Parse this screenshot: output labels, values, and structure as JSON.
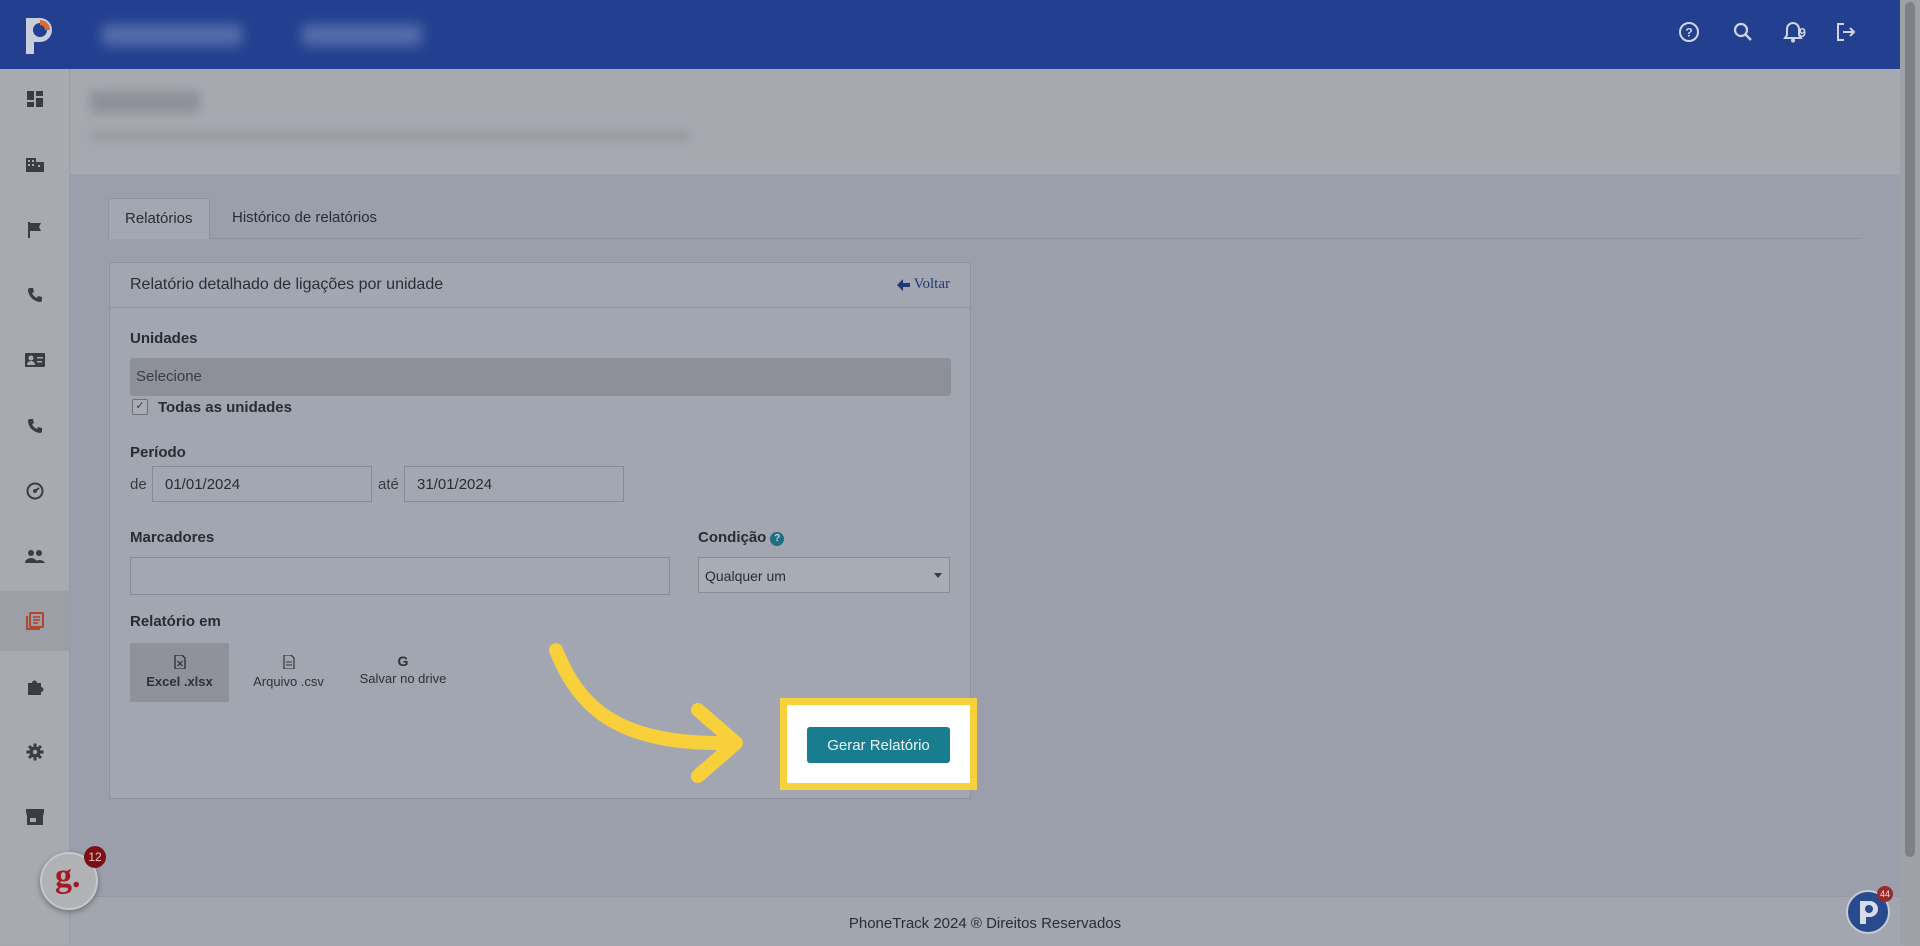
{
  "topbar": {
    "notification_count": "9",
    "icons": [
      "help-icon",
      "search-icon",
      "bell-icon",
      "logout-icon"
    ]
  },
  "sidebar": {
    "items": [
      {
        "icon": "dashboard-icon"
      },
      {
        "icon": "building-icon"
      },
      {
        "icon": "flag-icon"
      },
      {
        "icon": "phone-icon"
      },
      {
        "icon": "contact-card-icon"
      },
      {
        "icon": "phone-call-icon"
      },
      {
        "icon": "speed-icon"
      },
      {
        "icon": "users-icon"
      },
      {
        "icon": "reports-icon",
        "active": true
      },
      {
        "icon": "puzzle-icon"
      },
      {
        "icon": "gear-icon"
      },
      {
        "icon": "store-icon"
      }
    ]
  },
  "tabs": [
    {
      "label": "Relatórios",
      "active": true
    },
    {
      "label": "Histórico de relatórios",
      "active": false
    }
  ],
  "card": {
    "title": "Relatório detalhado de ligações por unidade",
    "back_label": "Voltar",
    "unidades_label": "Unidades",
    "unidades_placeholder": "Selecione",
    "todas_label": "Todas as unidades",
    "todas_checked": true,
    "periodo_label": "Período",
    "de_label": "de",
    "date_start": "01/01/2024",
    "ate_label": "até",
    "date_end": "31/01/2024",
    "marcadores_label": "Marcadores",
    "marcadores_value": "",
    "condicao_label": "Condição",
    "condicao_value": "Qualquer um",
    "relatorio_em_label": "Relatório em",
    "formats": [
      {
        "label": "Excel .xlsx",
        "icon": "excel-file-icon",
        "active": true
      },
      {
        "label": "Arquivo .csv",
        "icon": "csv-file-icon",
        "active": false
      },
      {
        "label": "Salvar no drive",
        "icon": "google-icon",
        "active": false
      }
    ],
    "generate_label": "Gerar Relatório"
  },
  "footer": {
    "text": "PhoneTrack 2024 ® Direitos Reservados"
  },
  "badges": {
    "g_count": "12",
    "chat_count": "44"
  },
  "colors": {
    "topbar": "#22408f",
    "accent": "#177d8f",
    "highlight": "#f7d03c",
    "active_icon": "#b2452b"
  }
}
